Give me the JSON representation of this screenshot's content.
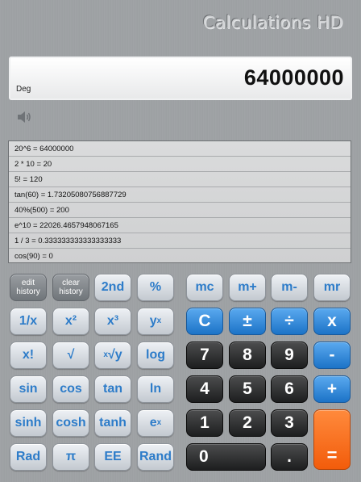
{
  "app": {
    "title": "Calculations HD"
  },
  "display": {
    "angle_mode": "Deg",
    "value": "64000000"
  },
  "icons": {
    "sound": "speaker-icon"
  },
  "history": [
    "20^6 = 64000000",
    "2 * 10 = 20",
    "5! = 120",
    "tan(60) = 1.73205080756887729",
    "40%(500) = 200",
    "e^10 = 22026.4657948067165",
    "1 / 3 = 0.333333333333333333",
    "cos(90) = 0"
  ],
  "keys": {
    "edit_history": "edit history",
    "clear_history": "clear history",
    "second": "2nd",
    "percent": "%",
    "reciprocal": "1/x",
    "square": "x²",
    "cube": "x³",
    "power_base": "y",
    "power_exp": "x",
    "factorial": "x!",
    "sqrt": "√",
    "root_index": "x",
    "root_radicand": "√y",
    "log": "log",
    "sin": "sin",
    "cos": "cos",
    "tan": "tan",
    "ln": "ln",
    "sinh": "sinh",
    "cosh": "cosh",
    "tanh": "tanh",
    "exp_base": "e",
    "exp_exp": "x",
    "rad": "Rad",
    "pi": "π",
    "ee": "EE",
    "rand": "Rand",
    "mc": "mc",
    "m_plus": "m+",
    "m_minus": "m-",
    "mr": "mr",
    "clear": "C",
    "plus_minus": "±",
    "divide": "÷",
    "multiply": "x",
    "subtract": "-",
    "add": "+",
    "equals": "=",
    "dot": ".",
    "d0": "0",
    "d1": "1",
    "d2": "2",
    "d3": "3",
    "d4": "4",
    "d5": "5",
    "d6": "6",
    "d7": "7",
    "d8": "8",
    "d9": "9"
  }
}
